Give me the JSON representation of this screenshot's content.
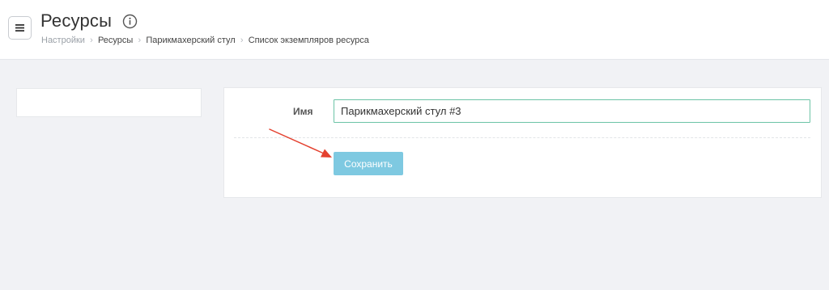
{
  "header": {
    "title": "Ресурсы",
    "menu_icon": "hamburger-menu-icon",
    "info_icon": "info-circle-icon"
  },
  "breadcrumb": {
    "items": [
      "Настройки",
      "Ресурсы",
      "Парикмахерский стул",
      "Список экземпляров ресурса"
    ],
    "separator_icon": "chevron-right-icon"
  },
  "form": {
    "name_label": "Имя",
    "name_value": "Парикмахерский стул #3",
    "save_label": "Сохранить"
  },
  "annotation": {
    "arrow_color": "#e4412f"
  },
  "colors": {
    "background": "#f1f2f5",
    "input_border_focus": "#6cc3a6",
    "save_button": "#7ec9e1"
  }
}
